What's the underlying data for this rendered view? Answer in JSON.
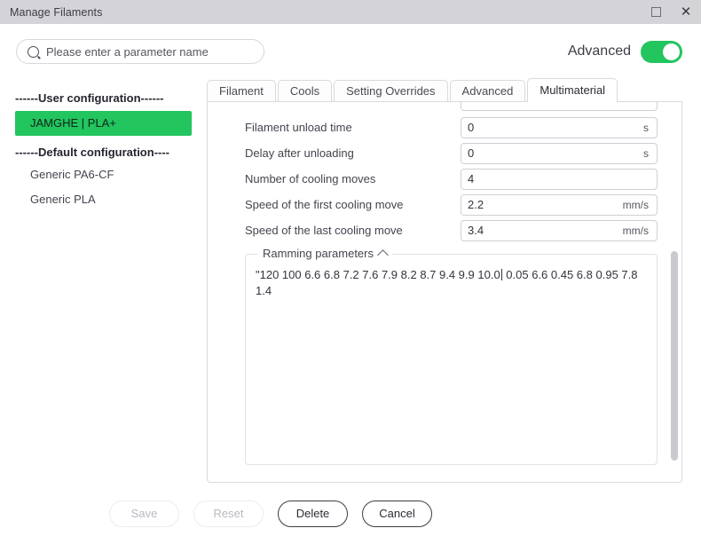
{
  "window": {
    "title": "Manage Filaments",
    "maximize_icon": "maximize-square-icon",
    "close_icon": "close-icon"
  },
  "search": {
    "placeholder": "Please enter a parameter name",
    "value": "",
    "icon": "search-icon"
  },
  "advanced": {
    "label": "Advanced",
    "enabled": true,
    "accent_color": "#22c55e"
  },
  "sidebar": {
    "groups": [
      {
        "title": "------User configuration------",
        "items": [
          {
            "label": "JAMGHE | PLA+",
            "selected": true
          }
        ]
      },
      {
        "title": "------Default configuration----",
        "items": [
          {
            "label": "Generic PA6-CF",
            "selected": false
          },
          {
            "label": "Generic PLA",
            "selected": false
          }
        ]
      }
    ]
  },
  "tabs": [
    {
      "label": "Filament",
      "active": false
    },
    {
      "label": "Cools",
      "active": false
    },
    {
      "label": "Setting Overrides",
      "active": false
    },
    {
      "label": "Advanced",
      "active": false
    },
    {
      "label": "Multimaterial",
      "active": true
    }
  ],
  "form": {
    "rows": [
      {
        "label": "Filament unload time",
        "value": "0",
        "unit": "s"
      },
      {
        "label": "Delay after unloading",
        "value": "0",
        "unit": "s"
      },
      {
        "label": "Number of cooling moves",
        "value": "4",
        "unit": ""
      },
      {
        "label": "Speed of the first cooling move",
        "value": "2.2",
        "unit": "mm/s"
      },
      {
        "label": "Speed of the last cooling move",
        "value": "3.4",
        "unit": "mm/s"
      }
    ]
  },
  "ramming": {
    "legend": "Ramming parameters",
    "collapse_icon": "chevron-up-icon",
    "text_before_caret": "\"120 100 6.6 6.8 7.2 7.6 7.9 8.2 8.7 9.4 9.9 10.0",
    "text_after_caret": " 0.05 6.6 0.45 6.8 0.95 7.8 1.4"
  },
  "footer": {
    "buttons": [
      {
        "label": "Save",
        "enabled": false
      },
      {
        "label": "Reset",
        "enabled": false
      },
      {
        "label": "Delete",
        "enabled": true
      },
      {
        "label": "Cancel",
        "enabled": true
      }
    ]
  }
}
